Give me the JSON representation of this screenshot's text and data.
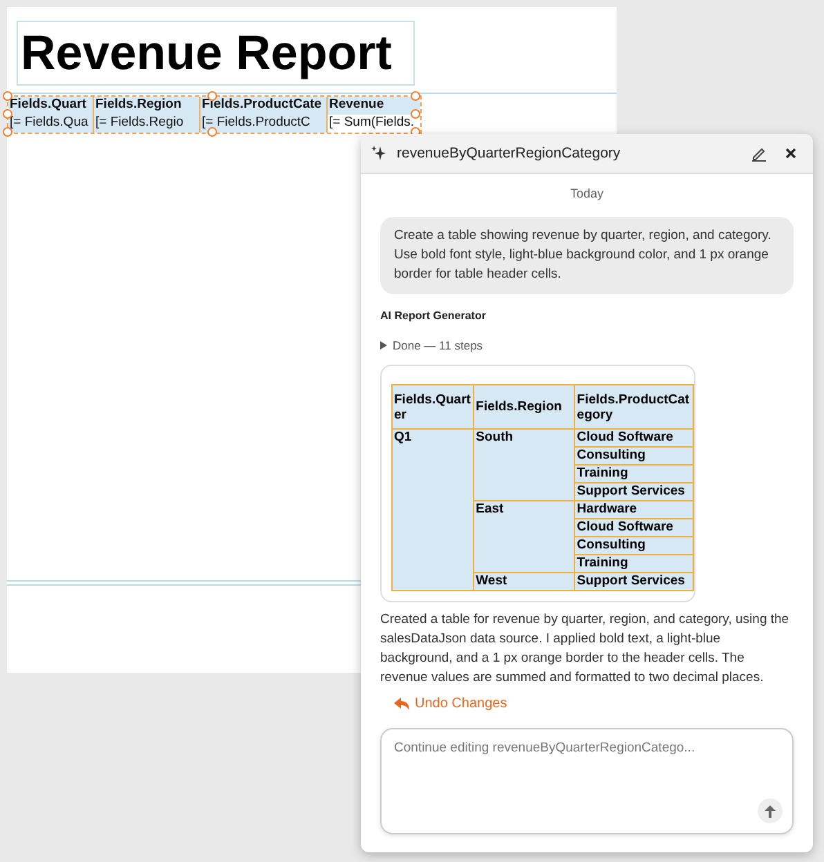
{
  "report": {
    "title": "Revenue Report",
    "table": {
      "header": [
        "Fields.Quart",
        "Fields.Region",
        "Fields.ProductCate",
        "Revenue"
      ],
      "row": [
        "[= Fields.Qua",
        "[= Fields.Regio",
        "[= Fields.ProductC",
        "[= Sum(Fields."
      ]
    }
  },
  "chat": {
    "title": "revenueByQuarterRegionCategory",
    "date_label": "Today",
    "user_message": "Create a table showing revenue by quarter, region, and category. Use bold font style, light-blue background color, and 1 px orange border for table header cells.",
    "sender": "AI Report Generator",
    "steps_label": "Done — 11 steps",
    "preview_table": {
      "columns": [
        "Fields.Quarter",
        "Fields.Region",
        "Fields.ProductCategory"
      ],
      "quarters": [
        {
          "name": "Q1",
          "regions": [
            {
              "name": "South",
              "categories": [
                "Cloud Software",
                "Consulting",
                "Training",
                "Support Services"
              ]
            },
            {
              "name": "East",
              "categories": [
                "Hardware",
                "Cloud Software",
                "Consulting",
                "Training"
              ]
            },
            {
              "name": "West",
              "categories": [
                "Support Services"
              ]
            }
          ]
        }
      ]
    },
    "response": "Created a table for revenue by quarter, region, and category, using the salesDataJson data source. I applied bold text, a light-blue background, and a 1 px orange border to the header cells. The revenue values are summed and formatted to two decimal places.",
    "undo_label": "Undo Changes",
    "input": {
      "placeholder": "Continue editing revenueByQuarterRegionCatego..."
    }
  }
}
